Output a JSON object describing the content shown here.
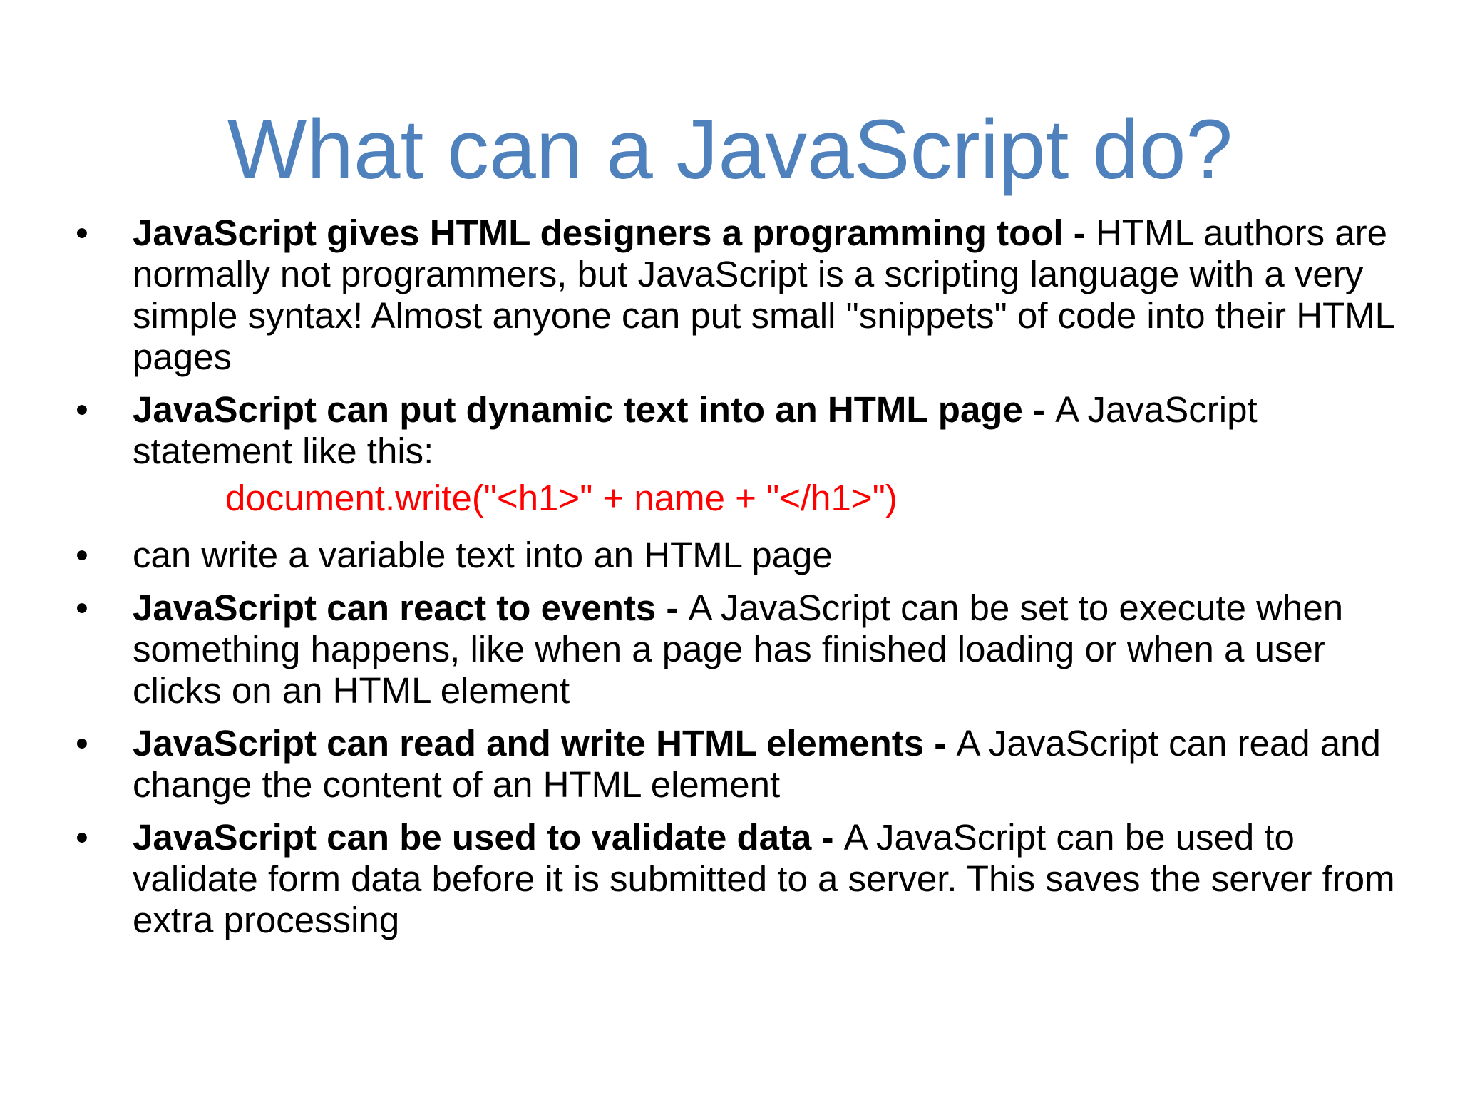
{
  "slide": {
    "title": "What can a JavaScript do?",
    "bullet_symbol": "•",
    "bullets": [
      {
        "lead": "JavaScript gives HTML designers a programming tool - ",
        "text": "HTML authors are normally not programmers, but JavaScript is a scripting language with a very simple syntax! Almost anyone can put small \"snippets\" of code into their HTML pages"
      },
      {
        "lead": "JavaScript can put dynamic text into an HTML page - ",
        "text": "A JavaScript statement like this:"
      },
      {
        "lead": "",
        "text": "can write a variable text into an HTML page"
      },
      {
        "lead": "JavaScript can react to events - ",
        "text": "A JavaScript can be set to execute when something happens, like when a page has finished loading or when a user clicks on an HTML element"
      },
      {
        "lead": "JavaScript can read and write HTML elements - ",
        "text": "A JavaScript can read and change the content of an HTML element"
      },
      {
        "lead": "JavaScript can be used to validate data - ",
        "text": "A JavaScript can be used to validate form data before it is submitted to a server. This saves the server from extra processing"
      }
    ],
    "code_example": "document.write(\"<h1>\" + name + \"</h1>\")"
  },
  "colors": {
    "title": "#4f81bd",
    "code": "#ff0000",
    "body": "#000000",
    "background": "#ffffff"
  }
}
